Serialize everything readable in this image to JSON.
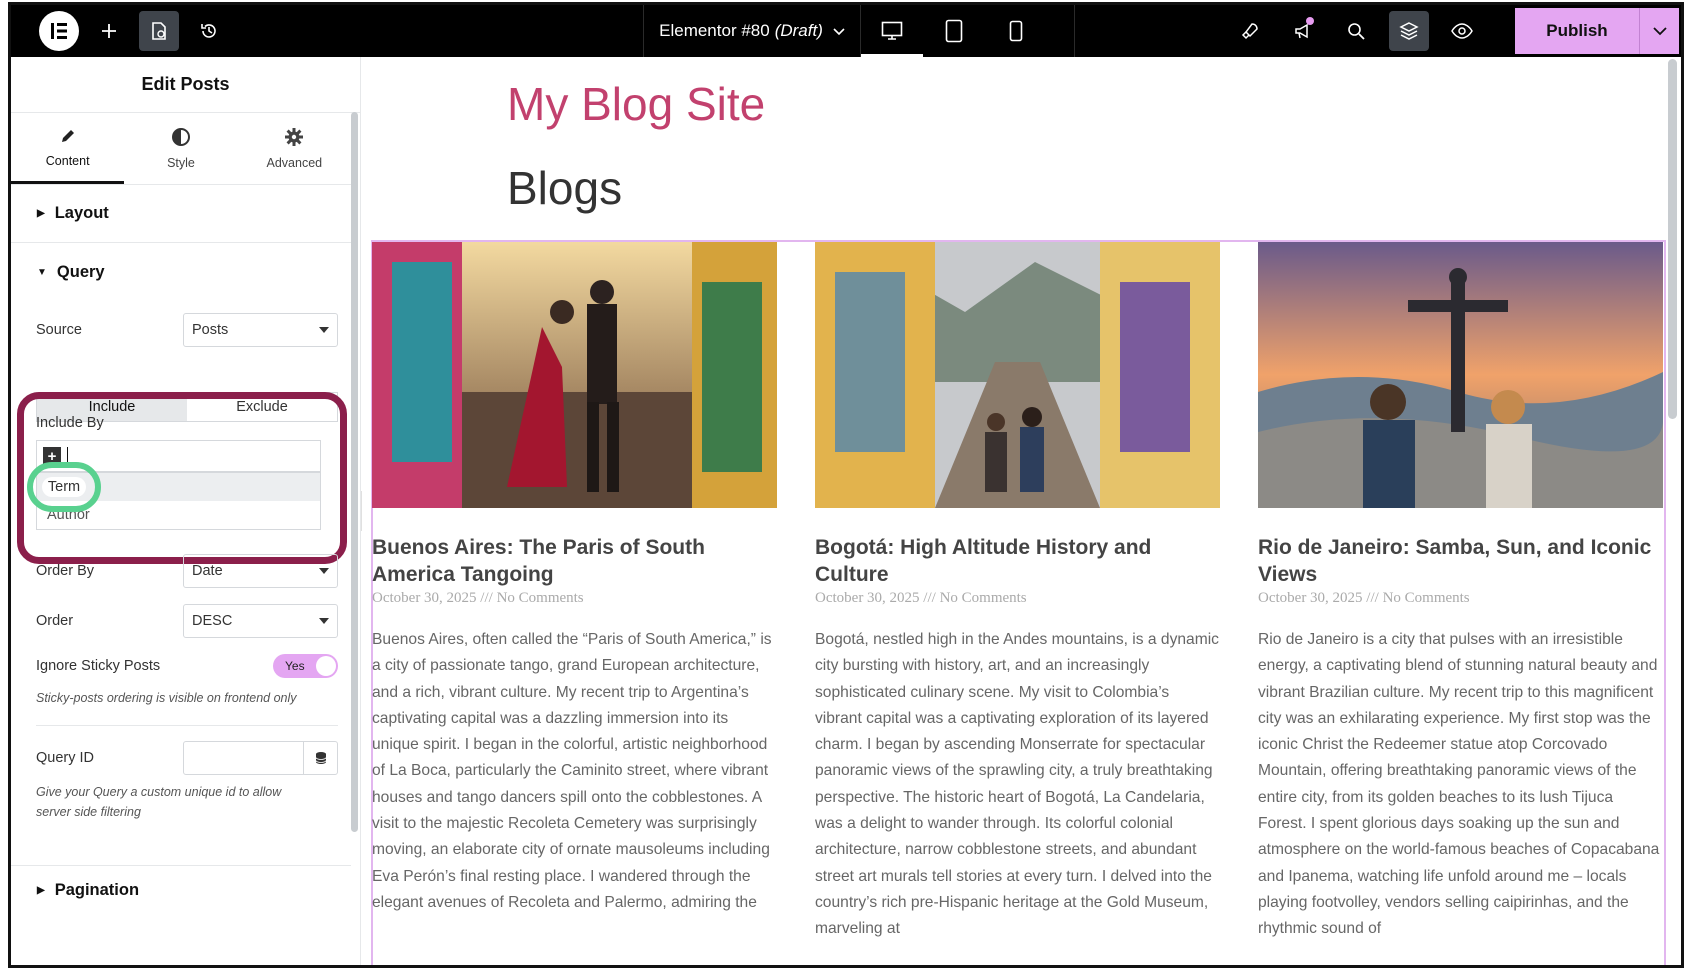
{
  "topbar": {
    "document_title": "Elementor #80",
    "document_status": "(Draft)",
    "publish_label": "Publish"
  },
  "panel": {
    "title": "Edit Posts",
    "tabs": [
      {
        "label": "Content",
        "icon": "pencil-icon",
        "active": true
      },
      {
        "label": "Style",
        "icon": "contrast-icon",
        "active": false
      },
      {
        "label": "Advanced",
        "icon": "gear-icon",
        "active": false
      }
    ],
    "layout_section": "Layout",
    "query_section": "Query",
    "source_label": "Source",
    "source_value": "Posts",
    "include_label": "Include",
    "exclude_label": "Exclude",
    "include_by_label": "Include By",
    "include_by_options": [
      "Term",
      "Author"
    ],
    "order_by_label": "Order By",
    "order_by_value": "Date",
    "order_label": "Order",
    "order_value": "DESC",
    "ignore_sticky_label": "Ignore Sticky Posts",
    "ignore_sticky_value": "Yes",
    "sticky_help": "Sticky-posts ordering is visible on frontend only",
    "query_id_label": "Query ID",
    "query_id_value": "",
    "query_id_help": "Give your Query a custom unique id to allow server side filtering",
    "pagination_section": "Pagination"
  },
  "preview": {
    "site_title": "My Blog Site",
    "page_title": "Blogs",
    "posts": [
      {
        "title": "Buenos Aires: The Paris of South America Tangoing",
        "meta": "October 30, 2025 /// No Comments",
        "excerpt": "Buenos Aires, often called the “Paris of South America,” is a city of passionate tango, grand European architecture, and a rich, vibrant culture. My recent trip to Argentina’s captivating capital was a dazzling immersion into its unique spirit. I began in the colorful, artistic neighborhood of La Boca, particularly the Caminito street, where vibrant houses and tango dancers spill onto the cobblestones. A visit to the majestic Recoleta Cemetery was surprisingly moving, an elaborate city of ornate mausoleums including Eva Perón’s final resting place. I wandered through the elegant avenues of Recoleta and Palermo, admiring the"
      },
      {
        "title": "Bogotá: High Altitude History and Culture",
        "meta": "October 30, 2025 /// No Comments",
        "excerpt": "Bogotá, nestled high in the Andes mountains, is a dynamic city bursting with history, art, and an increasingly sophisticated culinary scene. My visit to Colombia’s vibrant capital was a captivating exploration of its layered charm. I began by ascending Monserrate for spectacular panoramic views of the sprawling city, a truly breathtaking perspective. The historic heart of Bogotá, La Candelaria, was a delight to wander through. Its colorful colonial architecture, narrow cobblestone streets, and abundant street art murals tell stories at every turn. I delved into the country’s rich pre-Hispanic heritage at the Gold Museum, marveling at"
      },
      {
        "title": "Rio de Janeiro: Samba, Sun, and Iconic Views",
        "meta": "October 30, 2025 /// No Comments",
        "excerpt": "Rio de Janeiro is a city that pulses with an irresistible energy, a captivating blend of stunning natural beauty and vibrant Brazilian culture. My recent trip to this magnificent city was an exhilarating experience. My first stop was the iconic Christ the Redeemer statue atop Corcovado Mountain, offering breathtaking panoramic views of the entire city, from its golden beaches to its lush Tijuca Forest. I spent glorious days soaking up the sun and atmosphere on the world-famous beaches of Copacabana and Ipanema, watching life unfold around me – locals playing footvolley, vendors selling caipirinhas, and the rhythmic sound of"
      }
    ]
  },
  "colors": {
    "accent": "#e4a6f2",
    "site_title": "#c2416e",
    "highlight_ring": "#8b1f4b",
    "term_ring": "#59d18f"
  }
}
